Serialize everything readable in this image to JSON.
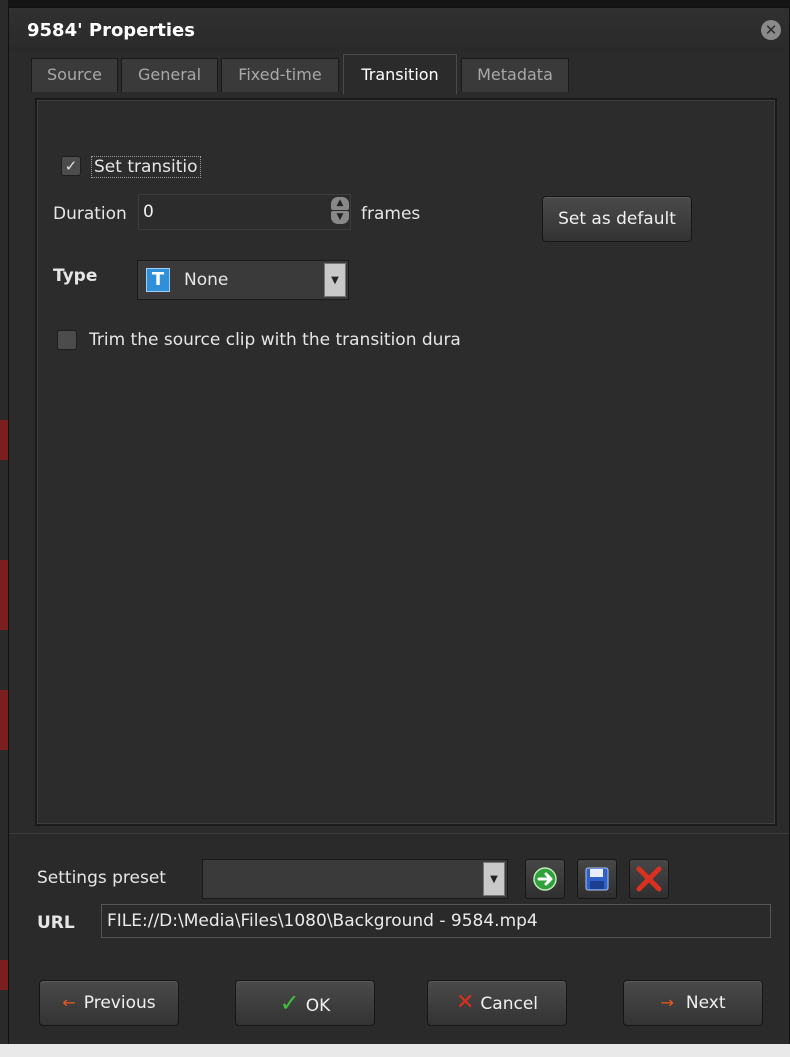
{
  "window": {
    "title": "9584' Properties",
    "close_glyph": "✕"
  },
  "tabs": [
    {
      "label": "Source",
      "active": false
    },
    {
      "label": "General",
      "active": false
    },
    {
      "label": "Fixed-time",
      "active": false
    },
    {
      "label": "Transition",
      "active": true
    },
    {
      "label": "Metadata",
      "active": false
    }
  ],
  "transition": {
    "set_transition_label": "Set transitio",
    "set_transition_checked": true,
    "duration_label": "Duration",
    "duration_value": "0",
    "frames_label": "frames",
    "set_default_label": "Set as default",
    "type_label": "Type",
    "type_value": "None",
    "type_icon_glyph": "T",
    "trim_label": "Trim the source clip with the transition dura",
    "trim_checked": false
  },
  "footer": {
    "preset_label": "Settings preset",
    "preset_value": "",
    "url_label": "URL",
    "url_value": "FILE://D:\\Media\\Files\\1080\\Background - 9584.mp4",
    "previous_label": "Previous",
    "ok_label": "OK",
    "cancel_label": "Cancel",
    "next_label": "Next"
  },
  "colors": {
    "dialog_bg": "#2b2b2b",
    "accent_blue": "#2f8fd8",
    "apply_green": "#2fa03a",
    "delete_red": "#d9301f",
    "arrow_orange": "#e85a1c"
  }
}
